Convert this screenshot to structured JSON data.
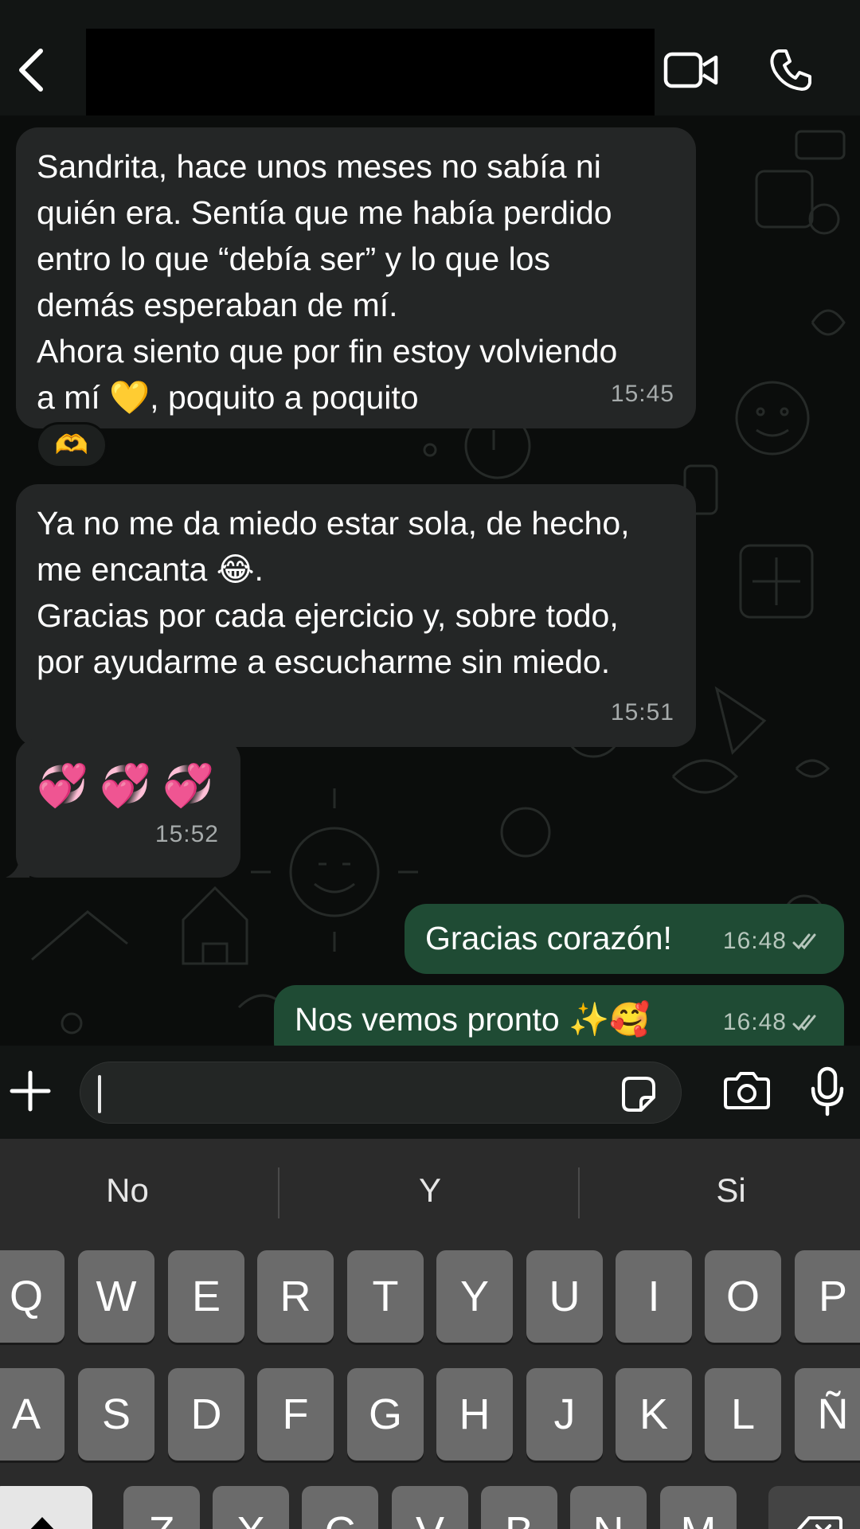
{
  "header": {
    "back_icon": "chevron-left-icon",
    "video_icon": "video-camera-icon",
    "call_icon": "phone-icon"
  },
  "messages": [
    {
      "direction": "incoming",
      "text": "Sandrita, hace unos meses no sabía ni\nquién era. Sentía que me había perdido\nentro lo que “debía ser” y lo que los\ndemás esperaban de mí.\nAhora siento que por fin estoy volviendo\na mí 💛, poquito a poquito",
      "time": "15:45",
      "reaction": "🫶"
    },
    {
      "direction": "incoming",
      "text": "Ya no me da miedo estar sola, de hecho,\nme encanta 😂.\nGracias por cada ejercicio y, sobre todo,\npor ayudarme a escucharme sin miedo.",
      "time": "15:51"
    },
    {
      "direction": "incoming",
      "text": "💞 💞 💞",
      "time": "15:52"
    },
    {
      "direction": "outgoing",
      "text": "Gracias corazón!",
      "time": "16:48",
      "status": "read"
    },
    {
      "direction": "outgoing",
      "text": "Nos vemos pronto ✨🥰",
      "time": "16:48",
      "status": "read"
    }
  ],
  "input": {
    "plus_icon": "plus-icon",
    "value": "",
    "sticker_icon": "sticker-icon",
    "camera_icon": "camera-icon",
    "mic_icon": "microphone-icon"
  },
  "keyboard": {
    "suggestions": [
      "No",
      "Y",
      "Si"
    ],
    "row1": [
      "Q",
      "W",
      "E",
      "R",
      "T",
      "Y",
      "U",
      "I",
      "O",
      "P"
    ],
    "row2": [
      "A",
      "S",
      "D",
      "F",
      "G",
      "H",
      "J",
      "K",
      "L",
      "Ñ"
    ],
    "row3": [
      "Z",
      "X",
      "C",
      "V",
      "B",
      "N",
      "M"
    ],
    "shift_icon": "shift-icon",
    "delete_icon": "backspace-icon"
  },
  "colors": {
    "incoming_bubble": "#242626",
    "outgoing_bubble": "#1f4b34",
    "background": "#0b0d0c"
  }
}
